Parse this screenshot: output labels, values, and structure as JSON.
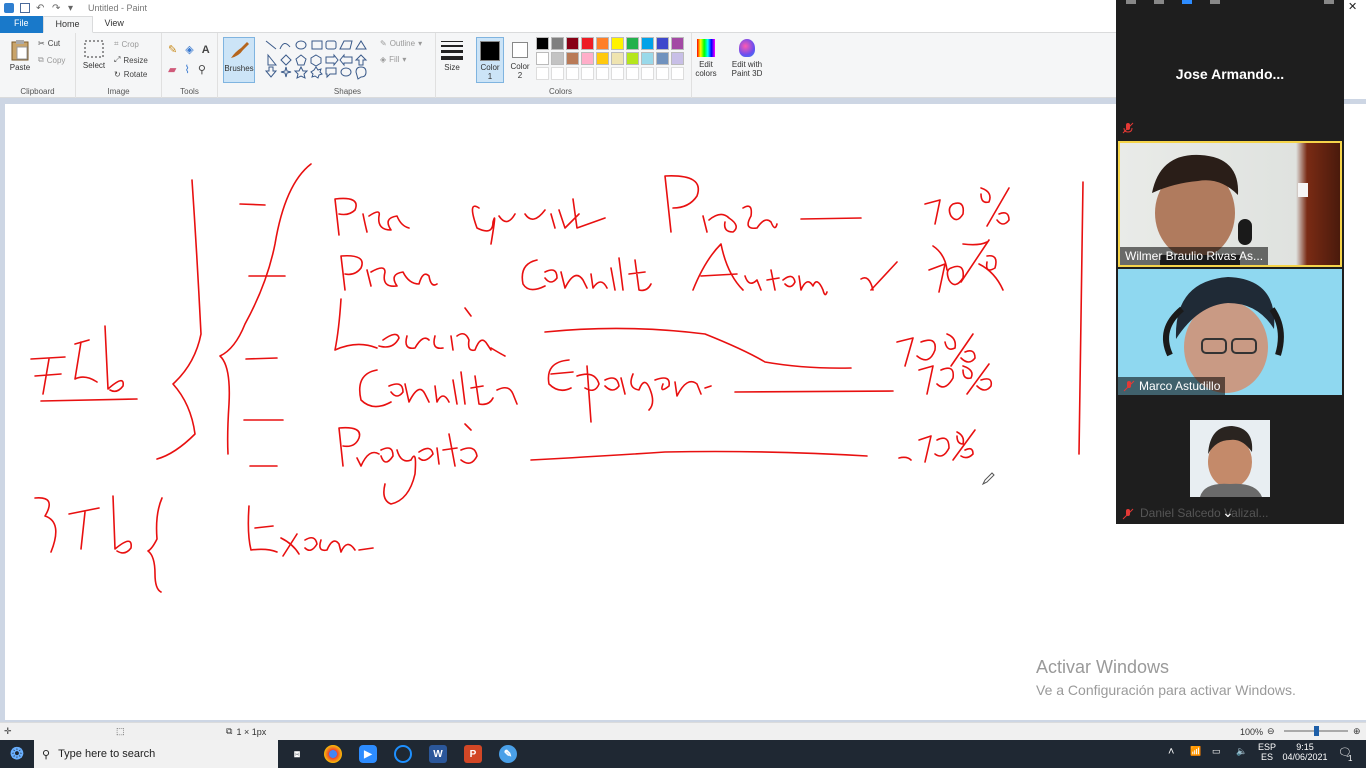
{
  "window": {
    "title": "Untitled - Paint",
    "close_glyph": "✕"
  },
  "tabs": [
    {
      "label": "File",
      "name": "tab-file"
    },
    {
      "label": "Home",
      "name": "tab-home"
    },
    {
      "label": "View",
      "name": "tab-view"
    }
  ],
  "ribbon": {
    "clipboard": {
      "paste": "Paste",
      "cut": "Cut",
      "copy": "Copy",
      "group_label": "Clipboard"
    },
    "image": {
      "select": "Select",
      "crop": "Crop",
      "resize": "Resize",
      "rotate": "Rotate",
      "group_label": "Image"
    },
    "tools": {
      "group_label": "Tools"
    },
    "brushes": {
      "label": "Brushes"
    },
    "shapes": {
      "outline": "Outline",
      "fill": "Fill",
      "group_label": "Shapes"
    },
    "size": {
      "label": "Size"
    },
    "color1": {
      "label_line1": "Color",
      "label_line2": "1",
      "value": "#000000"
    },
    "color2": {
      "label_line1": "Color",
      "label_line2": "2",
      "value": "#ffffff"
    },
    "colors": {
      "group_label": "Colors",
      "palette": [
        "#000000",
        "#7f7f7f",
        "#880015",
        "#ed1c24",
        "#ff7f27",
        "#fff200",
        "#22b14c",
        "#00a2e8",
        "#3f48cc",
        "#a349a4",
        "#ffffff",
        "#c3c3c3",
        "#b97a57",
        "#ffaec9",
        "#ffc90e",
        "#efe4b0",
        "#b5e61d",
        "#99d9ea",
        "#7092be",
        "#c8bfe7"
      ]
    },
    "edit_colors": {
      "line1": "Edit",
      "line2": "colors"
    },
    "paint3d": {
      "line1": "Edit with",
      "line2": "Paint 3D"
    }
  },
  "canvas": {
    "ink_color": "#e81010",
    "watermark": {
      "line1": "Activar Windows",
      "line2": "Ve a Configuración para activar Windows."
    }
  },
  "statusbar": {
    "canvas_size": "1 × 1px",
    "zoom": "100%",
    "zoom_fraction": 0.5
  },
  "taskbar": {
    "search_placeholder": "Type here to search",
    "tray": {
      "lang1": "ESP",
      "lang2": "ES",
      "time": "9:15",
      "date": "04/06/2021",
      "notification_count": "1"
    }
  },
  "zoom_panel": {
    "host_name": "Jose Armando...",
    "participants": [
      {
        "name": "Wilmer Braulio Rivas As...",
        "muted": false
      },
      {
        "name": "Marco Astudillo",
        "muted": true
      },
      {
        "name": "Daniel Salcedo Valizal...",
        "muted": true
      }
    ]
  }
}
